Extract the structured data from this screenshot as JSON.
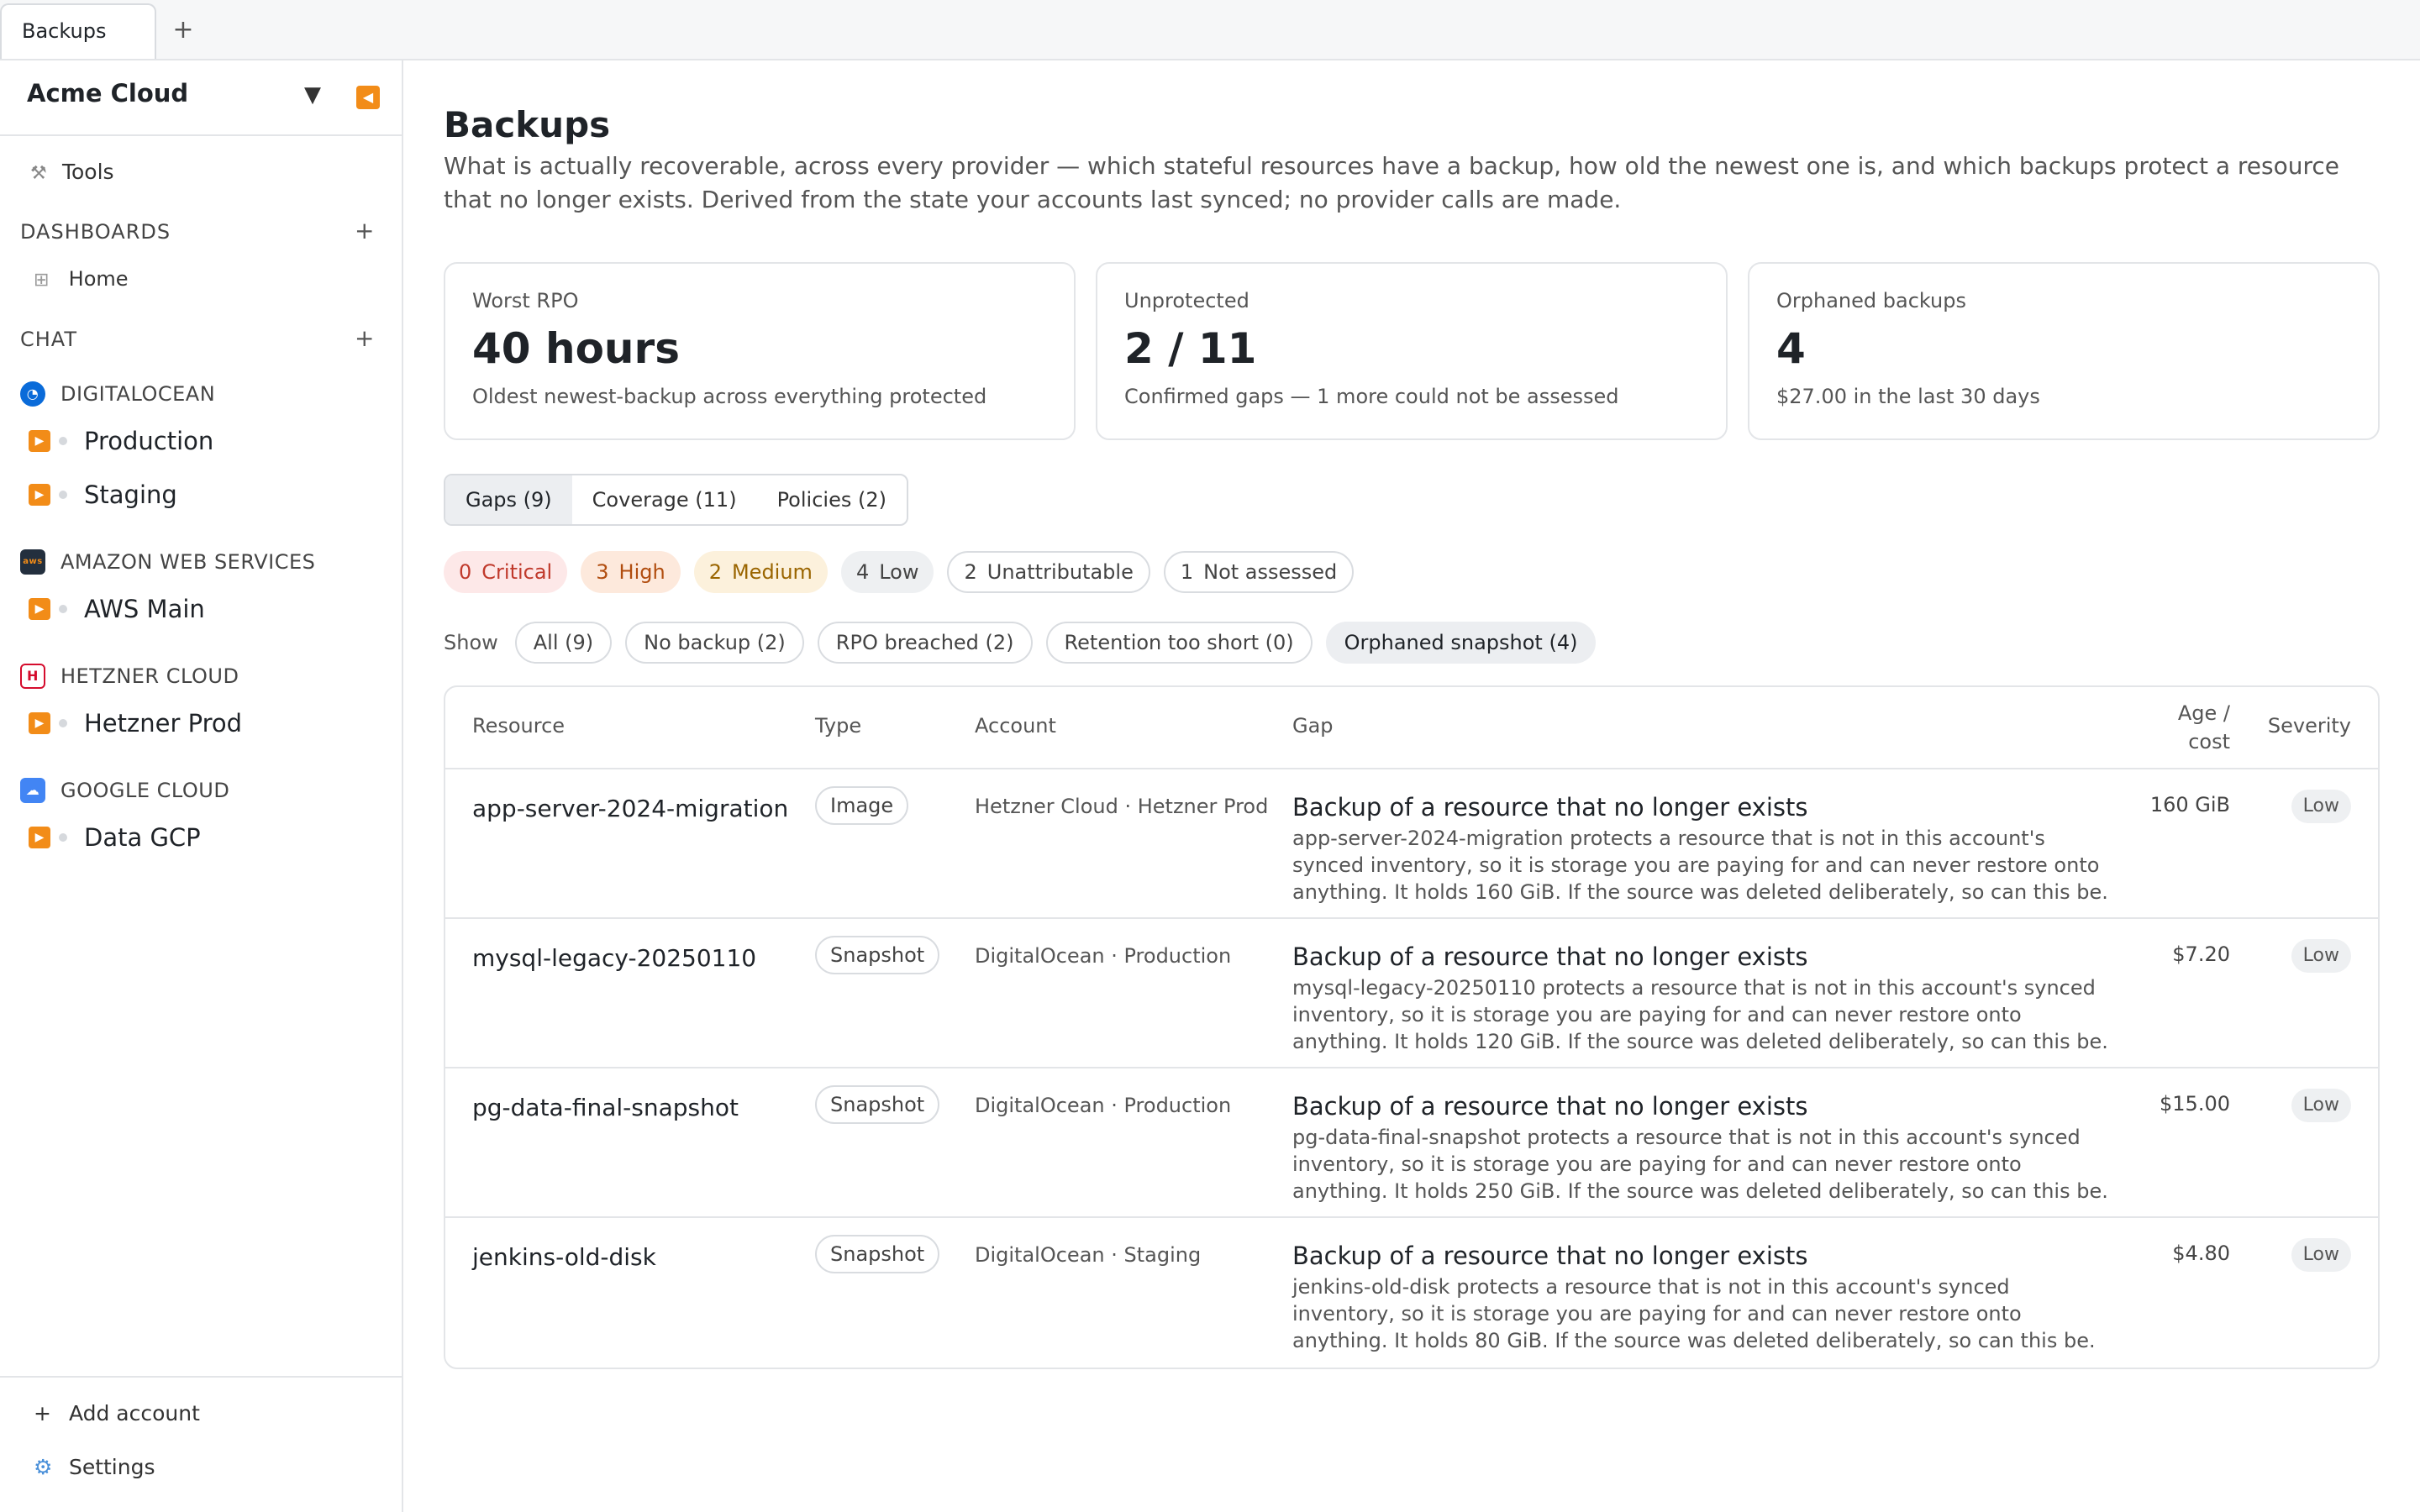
{
  "tabs": [
    {
      "label": "Backups"
    }
  ],
  "sidebar": {
    "org_name": "Acme Cloud",
    "tools_label": "Tools",
    "dashboards_header": "DASHBOARDS",
    "home_label": "Home",
    "chat_header": "CHAT",
    "providers": [
      {
        "name": "DIGITALOCEAN",
        "accounts": [
          "Production",
          "Staging"
        ]
      },
      {
        "name": "AMAZON WEB SERVICES",
        "accounts": [
          "AWS Main"
        ]
      },
      {
        "name": "HETZNER CLOUD",
        "accounts": [
          "Hetzner Prod"
        ]
      },
      {
        "name": "GOOGLE CLOUD",
        "accounts": [
          "Data GCP"
        ]
      }
    ],
    "add_account_label": "Add account",
    "settings_label": "Settings"
  },
  "page": {
    "title": "Backups",
    "description": "What is actually recoverable, across every provider — which stateful resources have a backup, how old the newest one is, and which backups protect a resource that no longer exists. Derived from the state your accounts last synced; no provider calls are made."
  },
  "cards": [
    {
      "label": "Worst RPO",
      "value": "40 hours",
      "sub": "Oldest newest-backup across everything protected"
    },
    {
      "label": "Unprotected",
      "value": "2 / 11",
      "sub": "Confirmed gaps — 1 more could not be assessed"
    },
    {
      "label": "Orphaned backups",
      "value": "4",
      "sub": "$27.00 in the last 30 days"
    }
  ],
  "view_tabs": [
    "Gaps (9)",
    "Coverage (11)",
    "Policies (2)"
  ],
  "severity_counts": [
    {
      "count": "0",
      "label": "Critical"
    },
    {
      "count": "3",
      "label": "High"
    },
    {
      "count": "2",
      "label": "Medium"
    },
    {
      "count": "4",
      "label": "Low"
    },
    {
      "count": "2",
      "label": "Unattributable"
    },
    {
      "count": "1",
      "label": "Not assessed"
    }
  ],
  "filters": {
    "label": "Show",
    "chips": [
      "All (9)",
      "No backup (2)",
      "RPO breached (2)",
      "Retention too short (0)",
      "Orphaned snapshot (4)"
    ],
    "active": "Orphaned snapshot (4)"
  },
  "table": {
    "columns": [
      "Resource",
      "Type",
      "Account",
      "Gap",
      "Age / cost",
      "Severity"
    ],
    "age_col_line1": "Age /",
    "age_col_line2": "cost",
    "rows": [
      {
        "resource": "app-server-2024-migration",
        "type": "Image",
        "account": "Hetzner Cloud · Hetzner Prod",
        "gap_title": "Backup of a resource that no longer exists",
        "gap_desc": "app-server-2024-migration protects a resource that is not in this account's synced inventory, so it is storage you are paying for and can never restore onto anything. It holds 160 GiB. If the source was deleted deliberately, so can this be.",
        "age_cost": "160 GiB",
        "severity": "Low"
      },
      {
        "resource": "mysql-legacy-20250110",
        "type": "Snapshot",
        "account": "DigitalOcean · Production",
        "gap_title": "Backup of a resource that no longer exists",
        "gap_desc": "mysql-legacy-20250110 protects a resource that is not in this account's synced inventory, so it is storage you are paying for and can never restore onto anything. It holds 120 GiB. If the source was deleted deliberately, so can this be.",
        "age_cost": "$7.20",
        "severity": "Low"
      },
      {
        "resource": "pg-data-final-snapshot",
        "type": "Snapshot",
        "account": "DigitalOcean · Production",
        "gap_title": "Backup of a resource that no longer exists",
        "gap_desc": "pg-data-final-snapshot protects a resource that is not in this account's synced inventory, so it is storage you are paying for and can never restore onto anything. It holds 250 GiB. If the source was deleted deliberately, so can this be.",
        "age_cost": "$15.00",
        "severity": "Low"
      },
      {
        "resource": "jenkins-old-disk",
        "type": "Snapshot",
        "account": "DigitalOcean · Staging",
        "gap_title": "Backup of a resource that no longer exists",
        "gap_desc": "jenkins-old-disk protects a resource that is not in this account's synced inventory, so it is storage you are paying for and can never restore onto anything. It holds 80 GiB. If the source was deleted deliberately, so can this be.",
        "age_cost": "$4.80",
        "severity": "Low"
      }
    ]
  },
  "colors": {
    "accent_orange": "#f28c18",
    "critical": "#c0392b",
    "high": "#b14d0f",
    "medium": "#9a6500"
  }
}
